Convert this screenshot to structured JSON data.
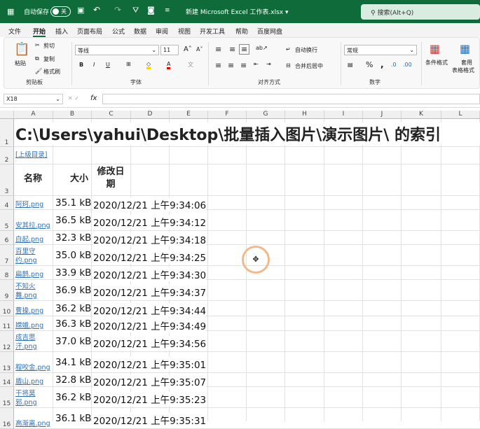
{
  "titlebar": {
    "autosave": "自动保存",
    "toggle": "关",
    "filename": "新建 Microsoft Excel 工作表.xlsx ▾",
    "search": "搜索(Alt+Q)"
  },
  "menu": [
    "文件",
    "开始",
    "插入",
    "页面布局",
    "公式",
    "数据",
    "审阅",
    "视图",
    "开发工具",
    "帮助",
    "百度网盘"
  ],
  "ribbon": {
    "paste": "粘贴",
    "cut": "剪切",
    "copy": "复制",
    "format_painter": "格式刷",
    "clipboard": "剪贴板",
    "font": "等线",
    "size": "11",
    "font_group": "字体",
    "wrap": "自动换行",
    "merge": "合并后居中",
    "align_group": "对齐方式",
    "numfmt": "常规",
    "number_group": "数字",
    "cond_format": "条件格式",
    "table_format_1": "套用",
    "table_format_2": "表格格式"
  },
  "formula": {
    "namebox": "X18",
    "fx": "fx",
    "value": ""
  },
  "columns": [
    "A",
    "B",
    "C",
    "D",
    "E",
    "F",
    "G",
    "H",
    "I",
    "J",
    "K",
    "L"
  ],
  "rows": [
    "1",
    "2",
    "3",
    "4",
    "5",
    "6",
    "7",
    "8",
    "9",
    "10",
    "11",
    "12",
    "13",
    "14",
    "15",
    "16"
  ],
  "sheet": {
    "title": "C:\\Users\\yahui\\Desktop\\批量插入图片\\演示图片\\ 的索引",
    "parent_link": "[上级目录]",
    "headers": [
      "名称",
      "大小",
      "修改日期"
    ],
    "files": [
      {
        "name": "阿珂.png",
        "size": "35.1 kB",
        "date": "2020/12/21 上午9:34:06"
      },
      {
        "name": "安其拉.png",
        "size": "36.5 kB",
        "date": "2020/12/21 上午9:34:12"
      },
      {
        "name": "白起.png",
        "size": "32.3 kB",
        "date": "2020/12/21 上午9:34:18"
      },
      {
        "name": "百里守约.png",
        "size": "35.0 kB",
        "date": "2020/12/21 上午9:34:25"
      },
      {
        "name": "扁鹊.png",
        "size": "33.9 kB",
        "date": "2020/12/21 上午9:34:30"
      },
      {
        "name": "不知火舞.png",
        "size": "36.9 kB",
        "date": "2020/12/21 上午9:34:37"
      },
      {
        "name": "曹操.png",
        "size": "36.2 kB",
        "date": "2020/12/21 上午9:34:44"
      },
      {
        "name": "嫦娥.png",
        "size": "36.3 kB",
        "date": "2020/12/21 上午9:34:49"
      },
      {
        "name": "成吉思汗.png",
        "size": "37.0 kB",
        "date": "2020/12/21 上午9:34:56"
      },
      {
        "name": "程咬金.png",
        "size": "34.1 kB",
        "date": "2020/12/21 上午9:35:01"
      },
      {
        "name": "盾山.png",
        "size": "32.8 kB",
        "date": "2020/12/21 上午9:35:07"
      },
      {
        "name": "干将莫邪.png",
        "size": "36.2 kB",
        "date": "2020/12/21 上午9:35:23"
      },
      {
        "name": "高渐离.png",
        "size": "36.1 kB",
        "date": "2020/12/21 上午9:35:31"
      }
    ]
  }
}
